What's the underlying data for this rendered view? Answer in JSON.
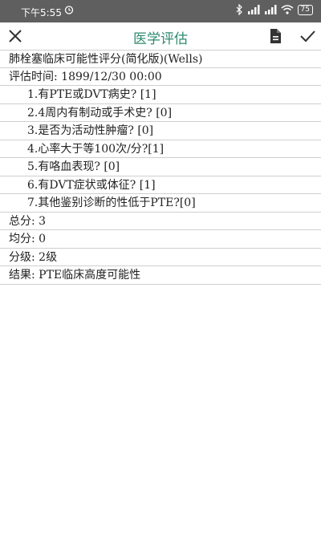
{
  "status_bar": {
    "time": "下午5:55",
    "battery": "75"
  },
  "toolbar": {
    "title": "医学评估"
  },
  "form": {
    "header": "肺栓塞临床可能性评分(简化版)(Wells)",
    "time_row": "评估时间: 1899/12/30 00:00",
    "items": [
      "1.有PTE或DVT病史? [1]",
      "2.4周内有制动或手术史? [0]",
      "3.是否为活动性肿瘤? [0]",
      "4.心率大于等100次/分?[1]",
      "5.有咯血表现? [0]",
      "6.有DVT症状或体征? [1]",
      "7.其他鉴别诊断的性低于PTE?[0]"
    ],
    "total": "总分: 3",
    "average": "均分: 0",
    "grade": "分级: 2级",
    "result": "结果: PTE临床高度可能性"
  }
}
